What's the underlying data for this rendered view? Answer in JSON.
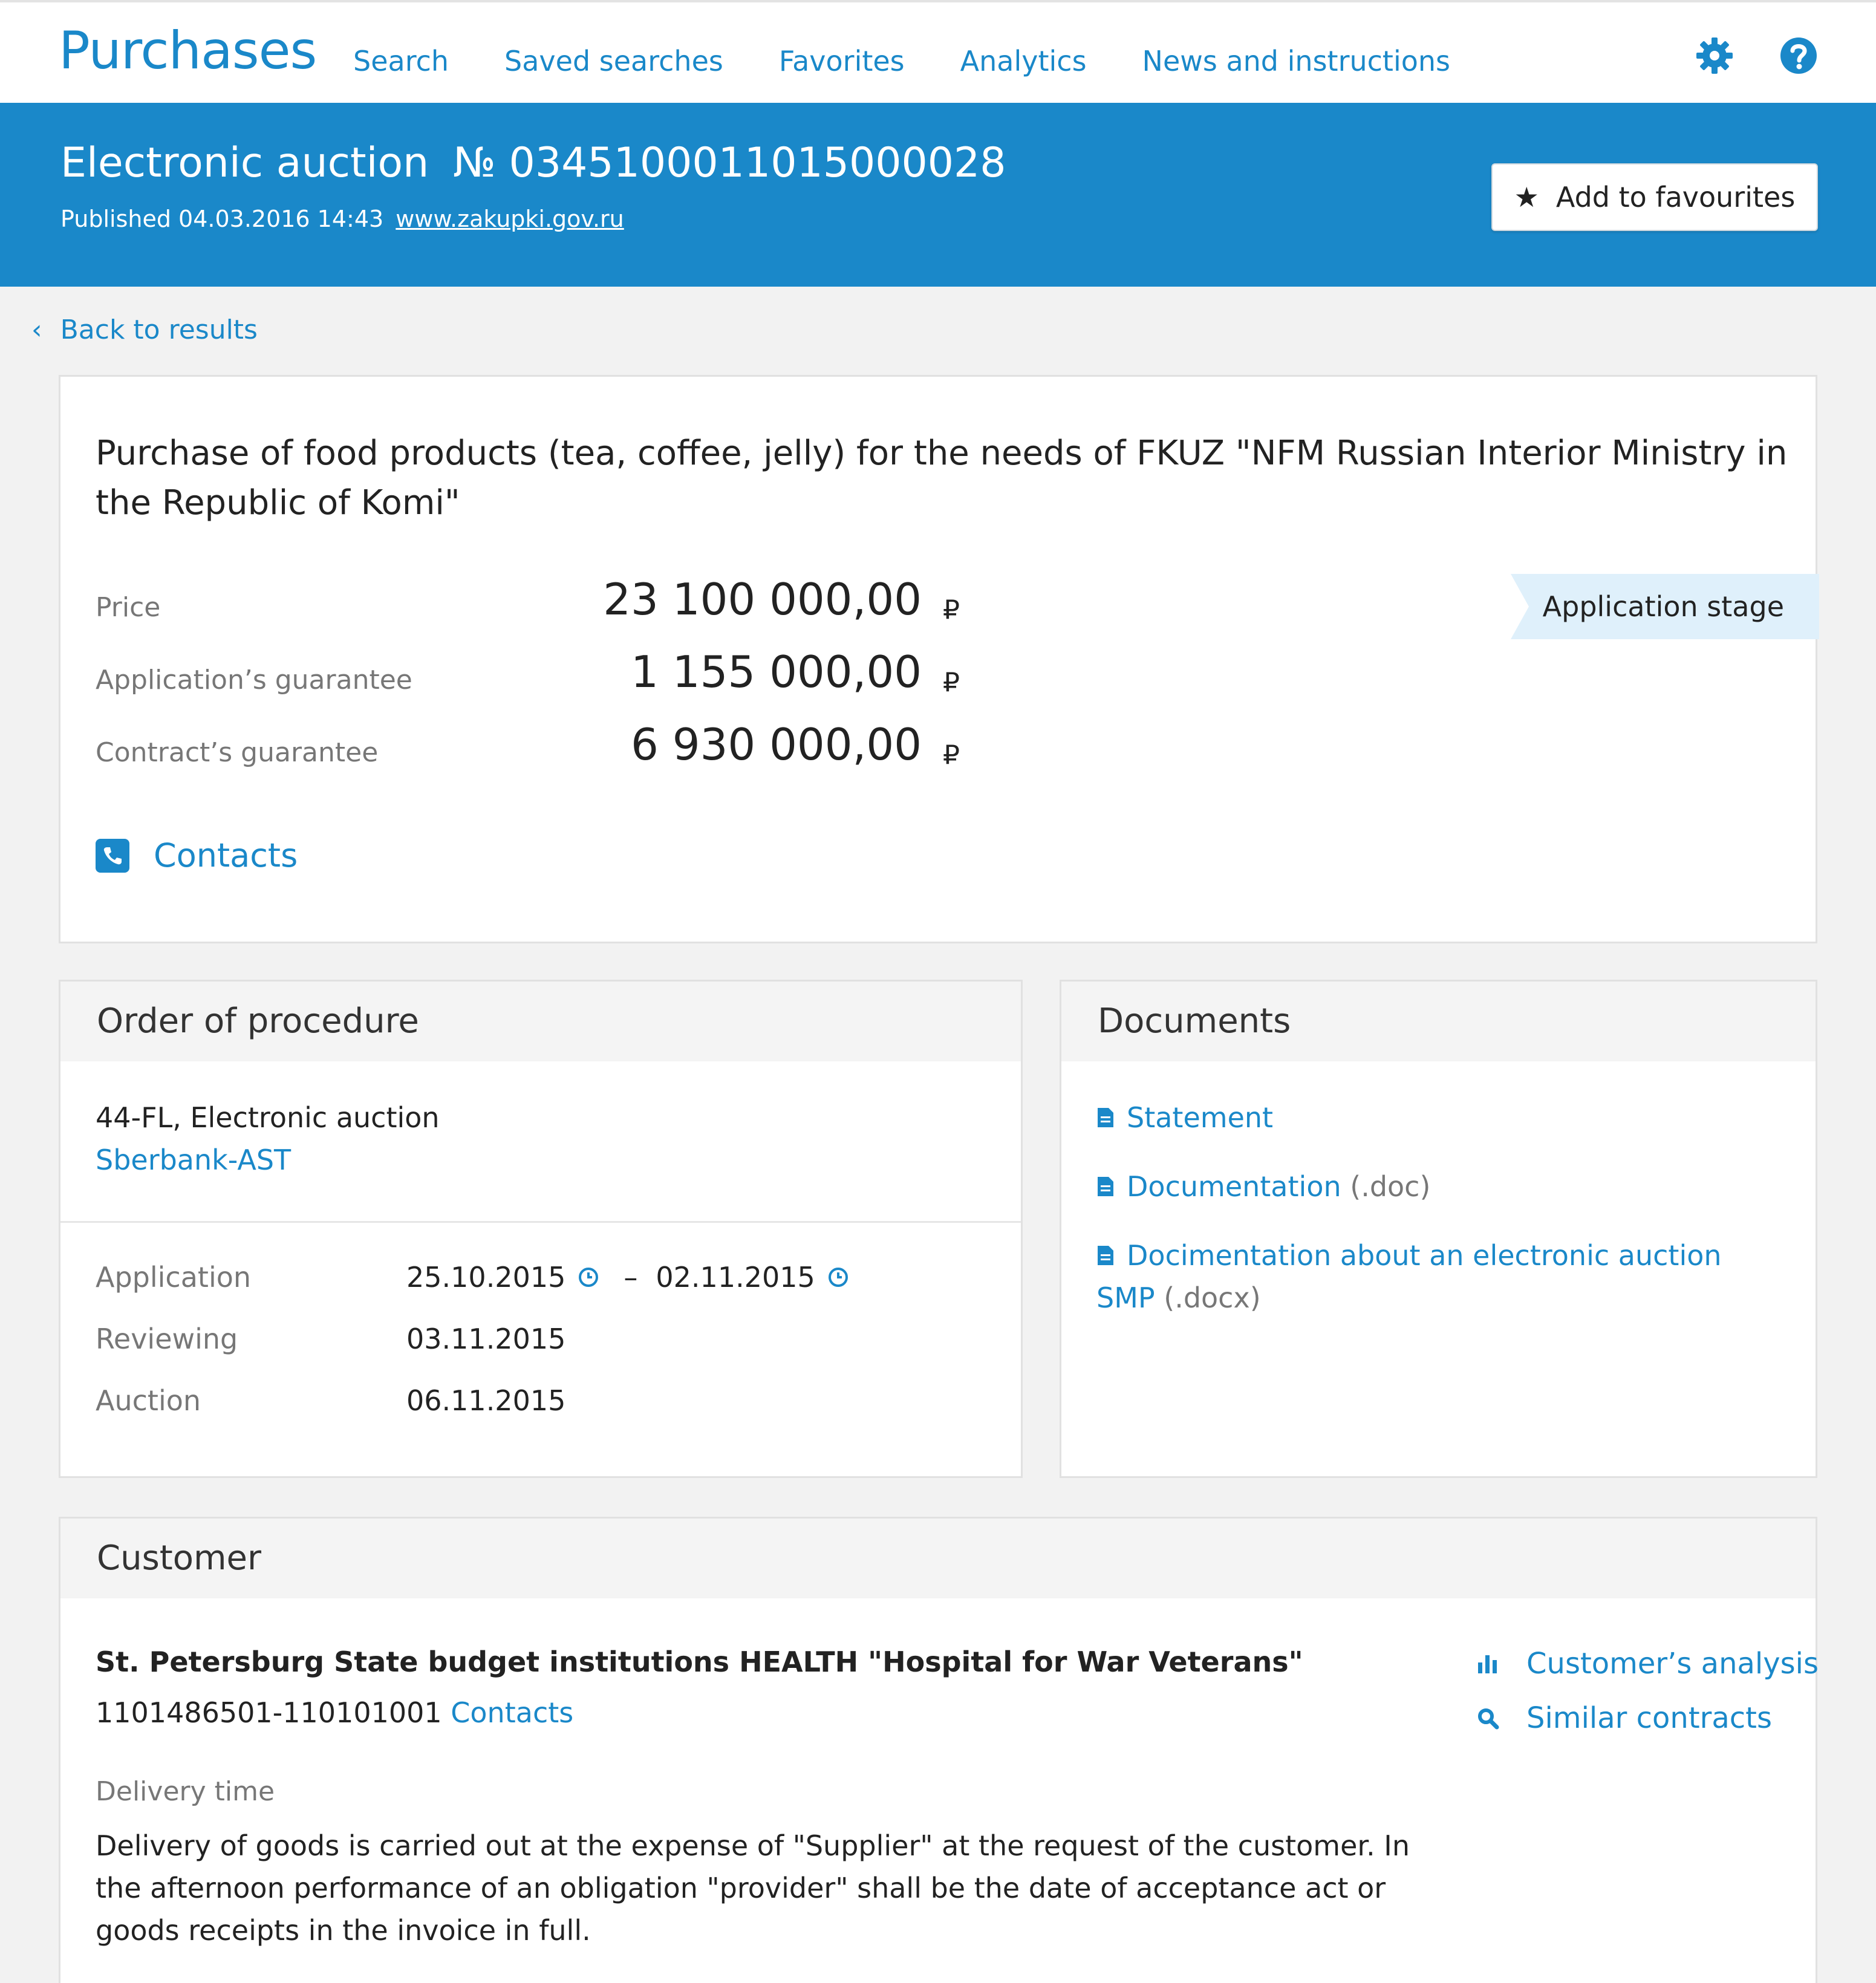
{
  "header": {
    "brand": "Purchases",
    "nav": [
      "Search",
      "Saved searches",
      "Favorites",
      "Analytics",
      "News and instructions"
    ],
    "icons": [
      "gear-icon",
      "help-icon"
    ]
  },
  "hero": {
    "title_type": "Electronic auction",
    "title_number": "№ 0345100011015000028",
    "published": "Published 04.03.2016 14:43",
    "site": "www.zakupki.gov.ru",
    "fav_button": "Add to favourites"
  },
  "back": "Back to results",
  "purchase": {
    "title": "Purchase of food products (tea, coffee, jelly) for the needs of FKUZ \"NFM Russian Interior Ministry in the Republic of Komi\"",
    "money": [
      {
        "label": "Price",
        "value": "23 100 000,00",
        "currency": "₽"
      },
      {
        "label": "Application’s guarantee",
        "value": "1 155 000,00",
        "currency": "₽"
      },
      {
        "label": "Contract’s guarantee",
        "value": "6 930 000,00",
        "currency": "₽"
      }
    ],
    "stage": "Application stage",
    "contacts": "Contacts"
  },
  "procedure": {
    "heading": "Order of procedure",
    "law": "44-FL, Electronic auction",
    "platform": "Sberbank-AST",
    "stages": [
      {
        "label": "Application",
        "from": "25.10.2015",
        "sep": "–",
        "to": "02.11.2015"
      },
      {
        "label": "Reviewing",
        "date": "03.11.2015"
      },
      {
        "label": "Auction",
        "date": "06.11.2015"
      }
    ]
  },
  "documents": {
    "heading": "Documents",
    "items": [
      {
        "name": "Statement",
        "ext": ""
      },
      {
        "name": "Documentation",
        "ext": "(.doc)"
      },
      {
        "name": "Docimentation about an electronic auction SMP",
        "ext": "(.docx)"
      }
    ]
  },
  "customer": {
    "heading": "Customer",
    "name": "St. Petersburg State budget institutions HEALTH \"Hospital for War Veterans\"",
    "ids": "1101486501-110101001",
    "contacts": "Contacts",
    "actions": [
      "Customer’s analysis",
      "Similar contracts"
    ],
    "delivery_label": "Delivery time",
    "delivery_text": "Delivery of goods is carried out at the expense of \"Supplier\" at the request of the customer. In the afternoon performance of an obligation \"provider\" shall be the date of acceptance act or goods receipts in the invoice in full."
  },
  "colors": {
    "accent": "#1a88c9",
    "stage_bg": "#dff0fb",
    "page_bg": "#f2f2f2"
  }
}
